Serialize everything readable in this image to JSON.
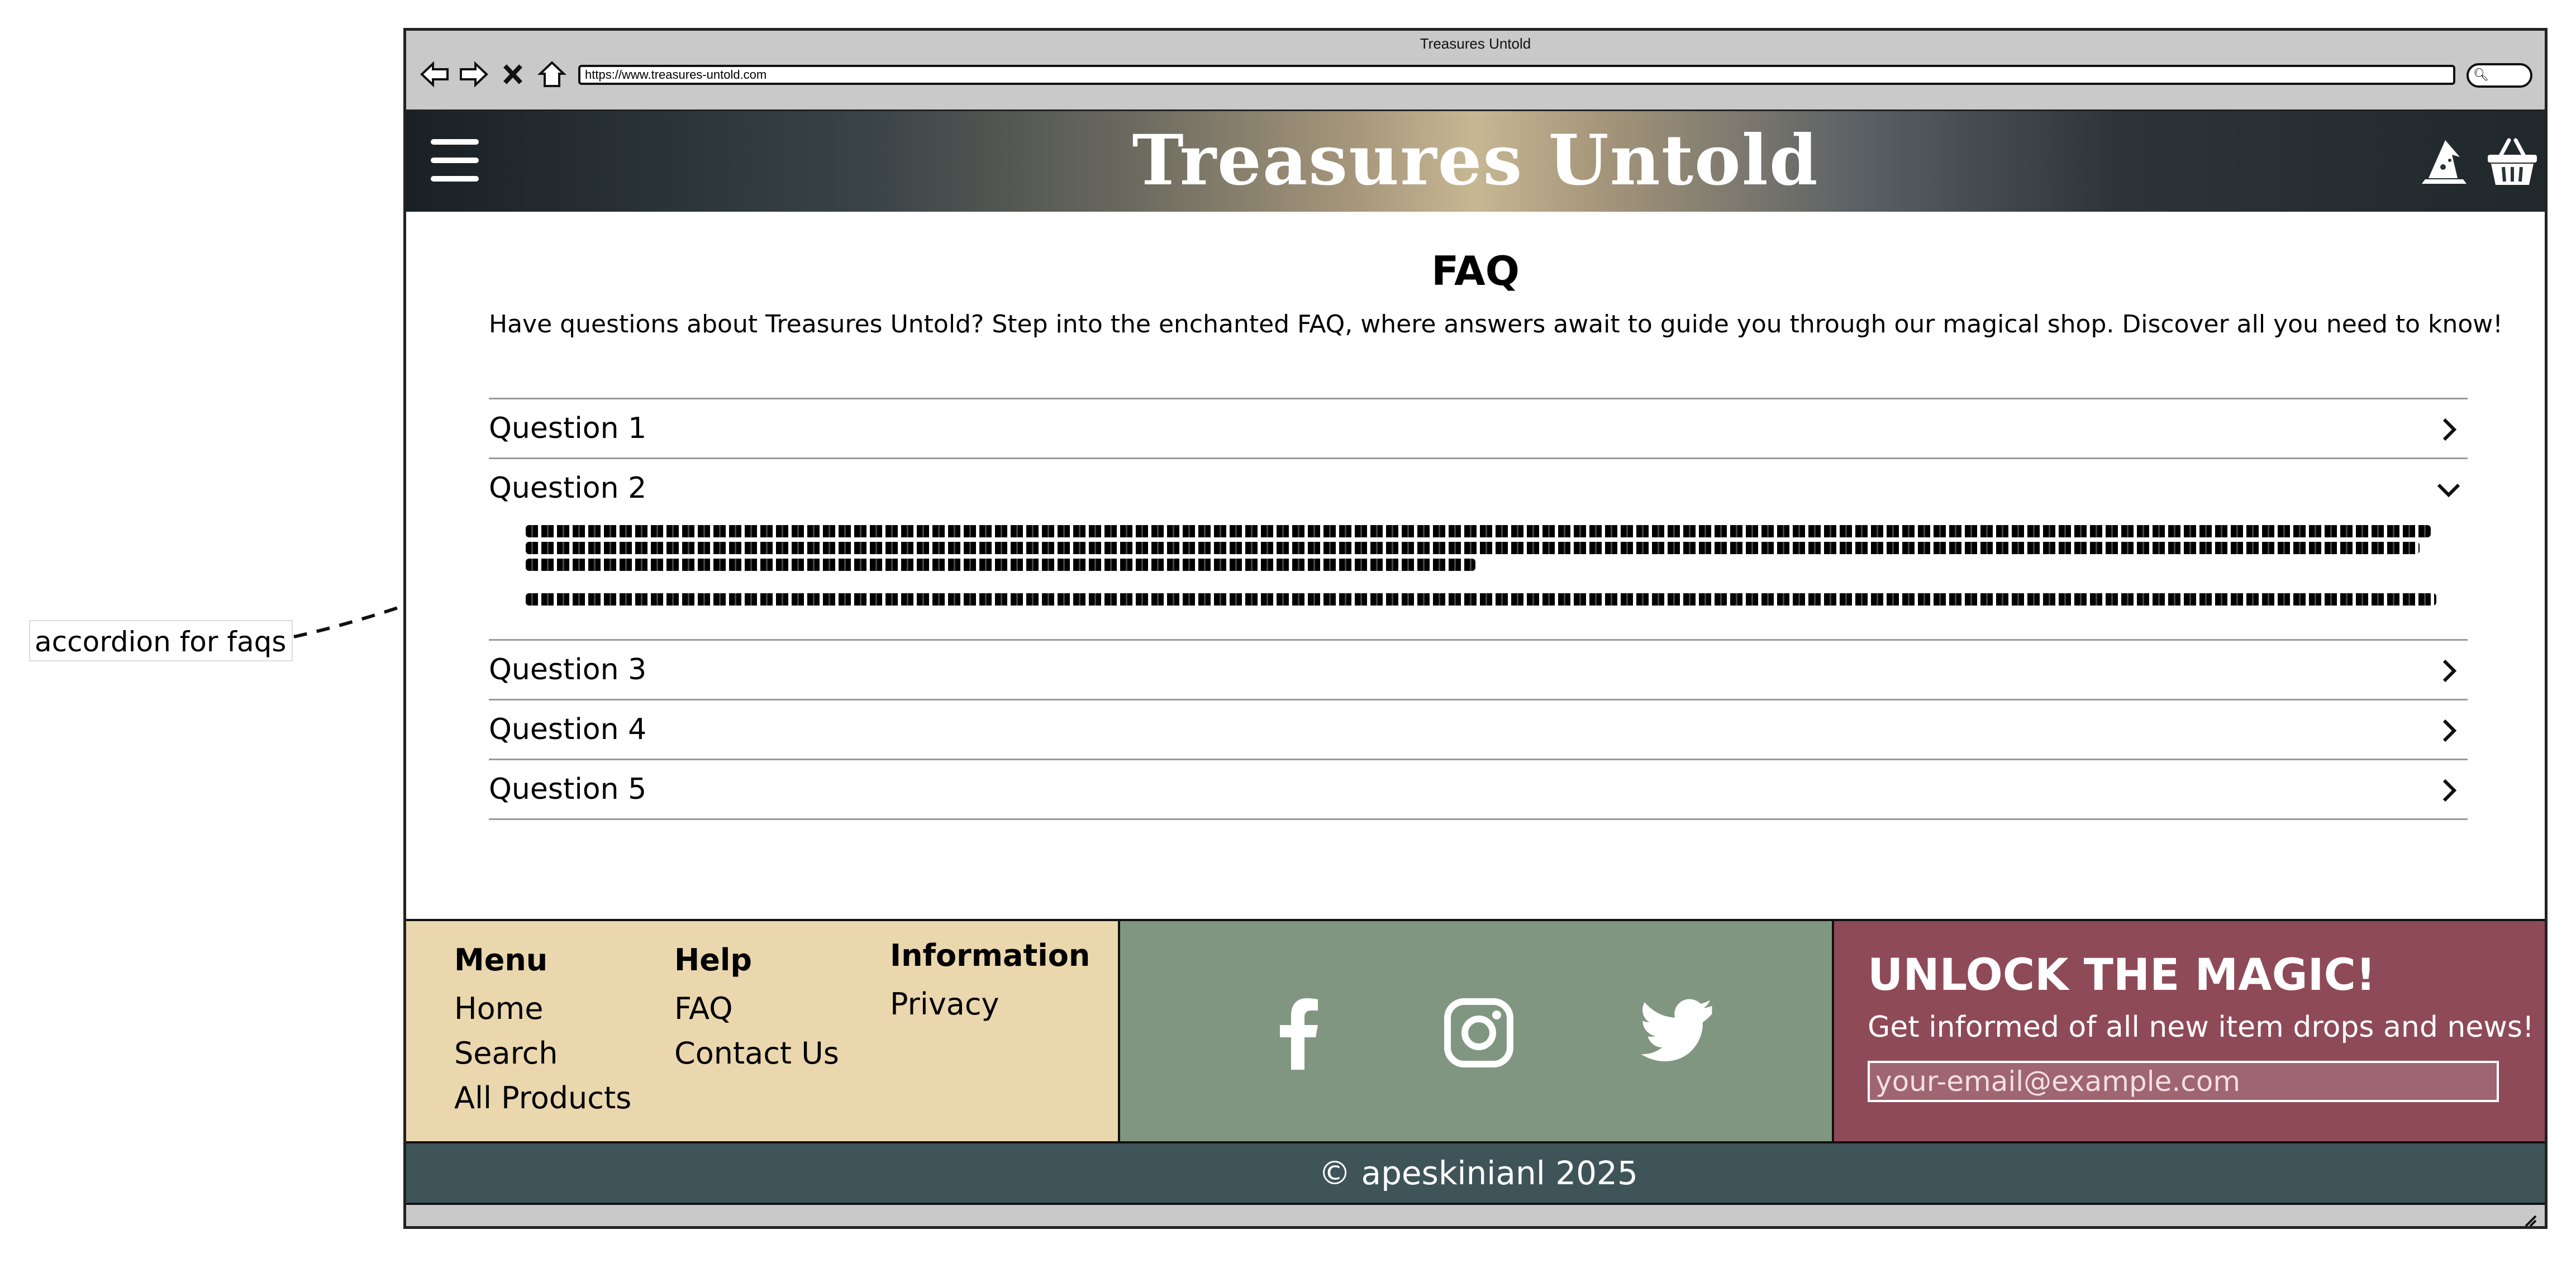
{
  "annotation": {
    "text": "accordion for faqs"
  },
  "browser": {
    "window_title": "Treasures Untold",
    "url": "https://www.treasures-untold.com",
    "nav_icons": [
      "back-icon",
      "forward-icon",
      "close-icon",
      "home-icon"
    ]
  },
  "header": {
    "logo": "Treasures Untold",
    "icons": [
      "hamburger-menu-icon",
      "wizard-hat-icon",
      "basket-icon"
    ]
  },
  "faq": {
    "title": "FAQ",
    "intro": "Have questions about Treasures Untold? Step into the enchanted FAQ, where answers await to guide you through our magical shop. Discover all you need to know!",
    "items": [
      {
        "label": "Question 1",
        "expanded": false
      },
      {
        "label": "Question 2",
        "expanded": true
      },
      {
        "label": "Question 3",
        "expanded": false
      },
      {
        "label": "Question 4",
        "expanded": false
      },
      {
        "label": "Question 5",
        "expanded": false
      }
    ]
  },
  "footer": {
    "menu": {
      "heading": "Menu",
      "links": [
        "Home",
        "Search",
        "All Products"
      ]
    },
    "help": {
      "heading": "Help",
      "links": [
        "FAQ",
        "Contact Us"
      ]
    },
    "information": {
      "heading": "Information",
      "links": [
        "Privacy"
      ]
    },
    "social": [
      "facebook-icon",
      "instagram-icon",
      "twitter-icon"
    ],
    "newsletter": {
      "title": "UNLOCK THE MAGIC!",
      "subtitle": "Get informed of all new item drops and news!",
      "placeholder": "your-email@example.com"
    },
    "copyright": "© apeskinianl 2025"
  },
  "colors": {
    "footer_links_bg": "#ead7ad",
    "footer_social_bg": "#819680",
    "footer_news_bg": "#8f4a57",
    "copyright_bg": "#3f5458"
  }
}
